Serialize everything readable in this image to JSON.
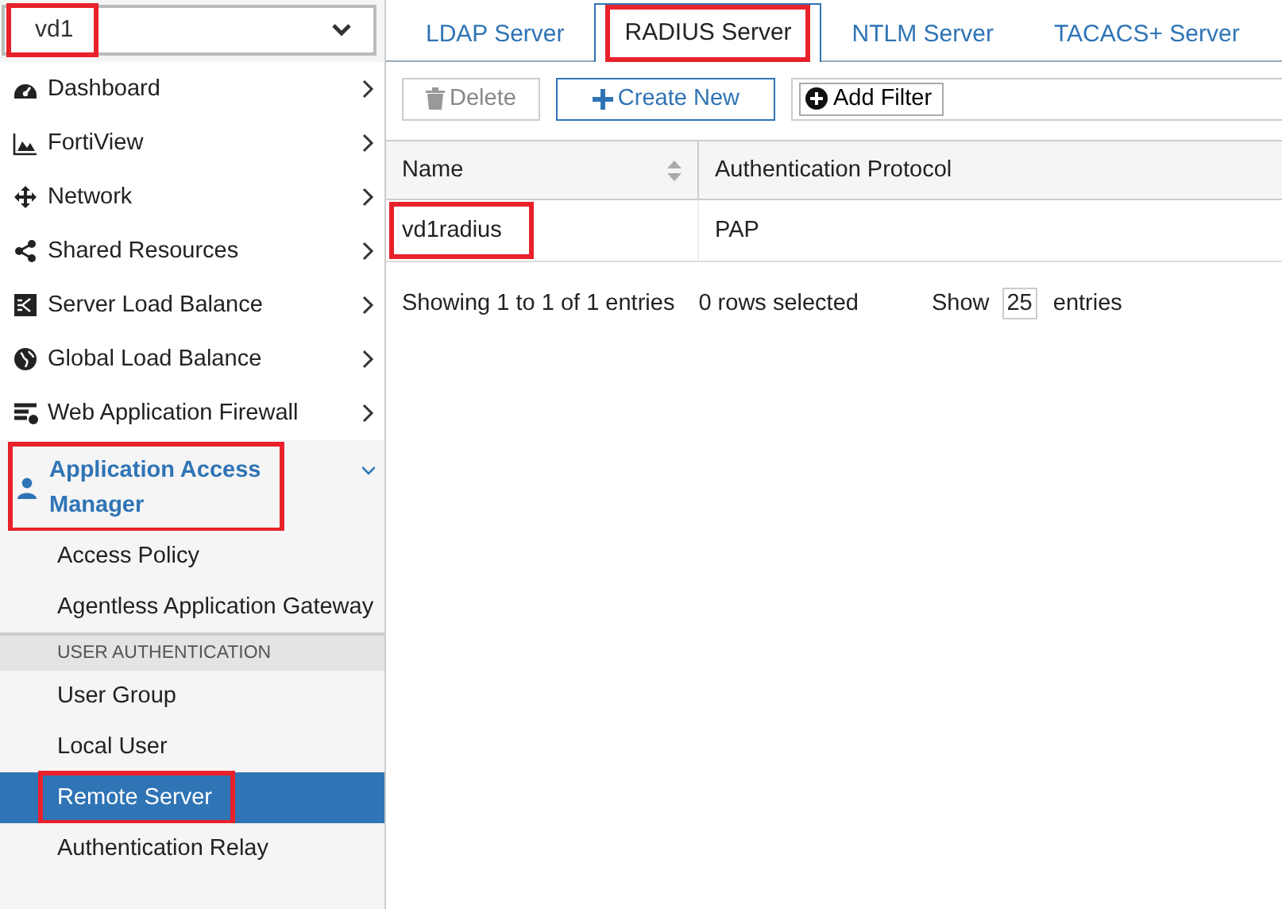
{
  "vdom_select": {
    "value": "vd1",
    "highlighted": true
  },
  "sidebar": {
    "items": [
      {
        "label": "Dashboard",
        "expanded": false,
        "highlighted": false
      },
      {
        "label": "FortiView",
        "expanded": false,
        "highlighted": false
      },
      {
        "label": "Network",
        "expanded": false,
        "highlighted": false
      },
      {
        "label": "Shared Resources",
        "expanded": false,
        "highlighted": false
      },
      {
        "label": "Server Load Balance",
        "expanded": false,
        "highlighted": false
      },
      {
        "label": "Global Load Balance",
        "expanded": false,
        "highlighted": false
      },
      {
        "label": "Web Application Firewall",
        "expanded": false,
        "highlighted": false
      },
      {
        "label": "Application Access Manager",
        "expanded": true,
        "highlighted": true,
        "children": [
          {
            "kind": "link",
            "label": "Access Policy",
            "selected": false,
            "highlighted": false
          },
          {
            "kind": "link",
            "label": "Agentless Application Gateway",
            "selected": false,
            "highlighted": false
          },
          {
            "kind": "section",
            "label": "USER AUTHENTICATION"
          },
          {
            "kind": "link",
            "label": "User Group",
            "selected": false,
            "highlighted": false
          },
          {
            "kind": "link",
            "label": "Local User",
            "selected": false,
            "highlighted": false
          },
          {
            "kind": "link",
            "label": "Remote Server",
            "selected": true,
            "highlighted": true
          },
          {
            "kind": "link",
            "label": "Authentication Relay",
            "selected": false,
            "highlighted": false
          }
        ]
      }
    ]
  },
  "tabs": [
    {
      "label": "LDAP Server",
      "selected": false,
      "highlighted": false
    },
    {
      "label": "RADIUS Server",
      "selected": true,
      "highlighted": true
    },
    {
      "label": "NTLM Server",
      "selected": false,
      "highlighted": false
    },
    {
      "label": "TACACS+ Server",
      "selected": false,
      "highlighted": false
    }
  ],
  "toolbar": {
    "delete": {
      "label": "Delete",
      "disabled": true
    },
    "create": {
      "label": "Create New"
    },
    "filter": {
      "label": "Add Filter"
    }
  },
  "table": {
    "columns": [
      "Name",
      "Authentication Protocol"
    ],
    "rows": [
      {
        "cells": [
          "vd1radius",
          "PAP"
        ],
        "highlighted": true
      }
    ]
  },
  "footer": {
    "showing": "Showing 1 to 1 of 1 entries",
    "selected": "0 rows selected",
    "show_label": "Show",
    "page_size": "25",
    "entries_label": "entries"
  }
}
